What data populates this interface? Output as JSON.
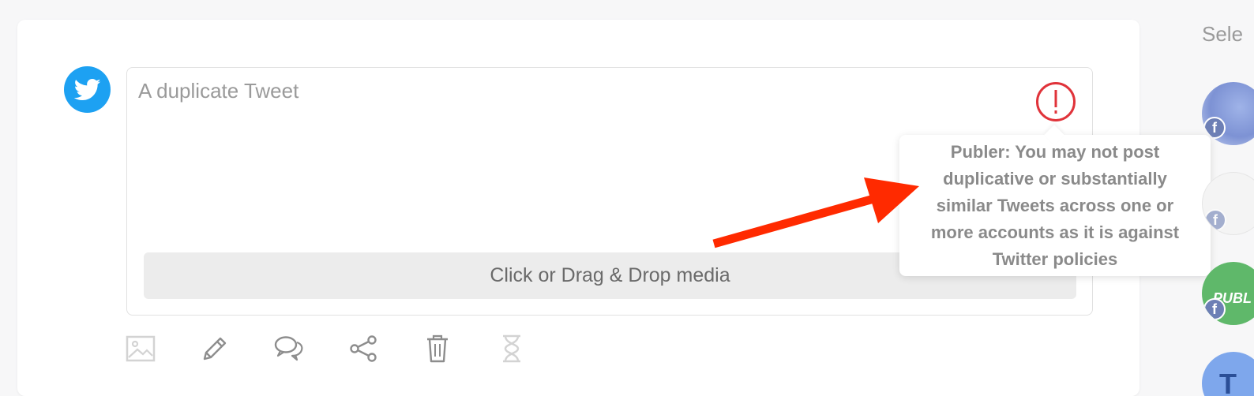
{
  "composer": {
    "placeholder": "A duplicate Tweet",
    "media_dropzone_label": "Click or Drag & Drop media"
  },
  "network": {
    "name": "twitter-icon",
    "color": "#1da1f2"
  },
  "warning": {
    "icon": "exclamation-circle-icon",
    "color": "#e0333a",
    "tooltip": "Publer: You may not post duplicative or substantially similar Tweets across one or more accounts as it is against Twitter policies"
  },
  "annotation": {
    "arrow_color": "#ff2a00"
  },
  "toolbar": {
    "items": [
      {
        "icon": "image-icon"
      },
      {
        "icon": "pencil-icon"
      },
      {
        "icon": "comments-icon"
      },
      {
        "icon": "share-icon"
      },
      {
        "icon": "trash-icon"
      },
      {
        "icon": "hourglass-icon"
      }
    ]
  },
  "sidebar": {
    "label": "Sele",
    "accounts": [
      {
        "initial": "",
        "network_badge": "f"
      },
      {
        "initial": "",
        "network_badge": "f"
      },
      {
        "initial": "PUBL",
        "network_badge": "f"
      },
      {
        "initial": "T",
        "network_badge": ""
      }
    ]
  }
}
